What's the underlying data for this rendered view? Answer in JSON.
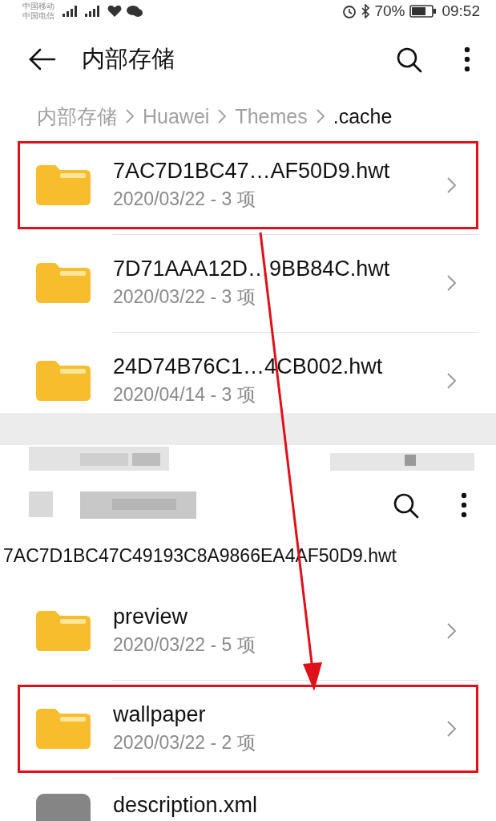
{
  "top_screen": {
    "status_bar": {
      "carriers": [
        "中国移动",
        "中国电信"
      ],
      "battery": "70%",
      "time": "09:52"
    },
    "toolbar": {
      "title": "内部存储"
    },
    "breadcrumb": [
      {
        "label": "内部存储",
        "current": false
      },
      {
        "label": "Huawei",
        "current": false
      },
      {
        "label": "Themes",
        "current": false
      },
      {
        "label": ".cache",
        "current": true
      }
    ],
    "items": [
      {
        "kind": "folder",
        "name": "7AC7D1BC47…AF50D9.hwt",
        "details": "2020/03/22 - 3 项",
        "highlighted": true
      },
      {
        "kind": "folder",
        "name": "7D71AAA12D…9BB84C.hwt",
        "details": "2020/03/22 - 3 项",
        "highlighted": false
      },
      {
        "kind": "folder",
        "name": "24D74B76C1…4CB002.hwt",
        "details": "2020/04/14 - 3 项",
        "highlighted": false
      }
    ]
  },
  "bottom_screen": {
    "path": "7AC7D1BC47C49193C8A9866EA4AF50D9.hwt",
    "items": [
      {
        "kind": "folder",
        "name": "preview",
        "details": "2020/03/22 - 5 项",
        "highlighted": false
      },
      {
        "kind": "folder",
        "name": "wallpaper",
        "details": "2020/03/22 - 2 项",
        "highlighted": true
      },
      {
        "kind": "file",
        "name": "description.xml"
      }
    ]
  },
  "annotations": [
    {
      "kind": "arrow"
    }
  ]
}
